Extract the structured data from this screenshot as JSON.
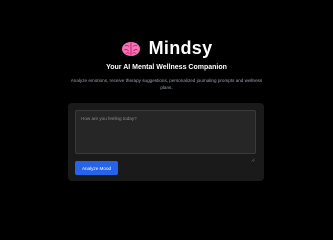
{
  "header": {
    "icon": "brain-icon",
    "title": "Mindsy",
    "tagline": "Your AI Mental Wellness Companion",
    "description": "Analyze emotions, receive therapy suggestions, personalized journaling prompts and wellness plans."
  },
  "mood_form": {
    "placeholder": "How are you feeling today?",
    "value": "",
    "submit_label": "Analyze Mood"
  },
  "colors": {
    "background": "#000000",
    "card": "#1a1a1a",
    "accent": "#2563eb",
    "brain": "#ec4899"
  }
}
